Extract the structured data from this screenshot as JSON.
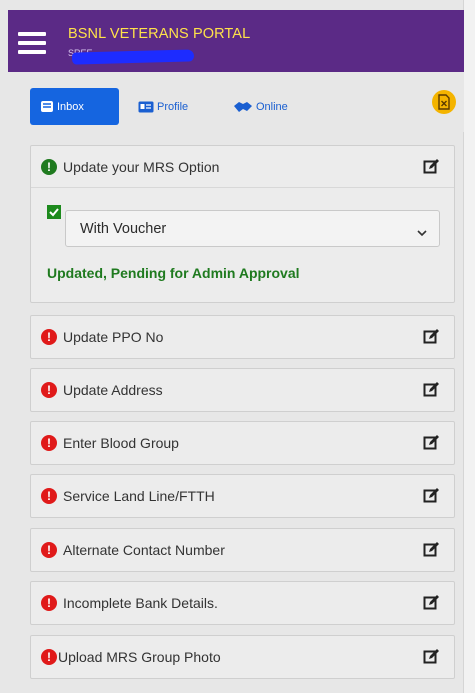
{
  "header": {
    "title": "BSNL VETERANS PORTAL",
    "user_text": "SREE ..."
  },
  "nav": {
    "inbox_label": "Inbox",
    "profile_label": "Profile",
    "online_label": "Online",
    "pdf_icon": "pdf-file-icon"
  },
  "mrs": {
    "title": "Update your MRS Option",
    "checkbox_checked": true,
    "selected_option": "With Voucher",
    "status": "Updated, Pending for Admin Approval",
    "status_color": "#1f7a1f"
  },
  "tasks": [
    {
      "label": "Update PPO No"
    },
    {
      "label": "Update Address"
    },
    {
      "label": "Enter Blood Group"
    },
    {
      "label": "Service Land Line/FTTH"
    },
    {
      "label": "Alternate Contact Number"
    },
    {
      "label": "Incomplete Bank Details."
    },
    {
      "label": "Upload MRS Group Photo"
    }
  ],
  "colors": {
    "header_bg": "#5b2a86",
    "header_title": "#ffe24a",
    "active_tab": "#1565e0",
    "alert_red": "#e01a1a",
    "alert_green": "#1f7a1f"
  }
}
